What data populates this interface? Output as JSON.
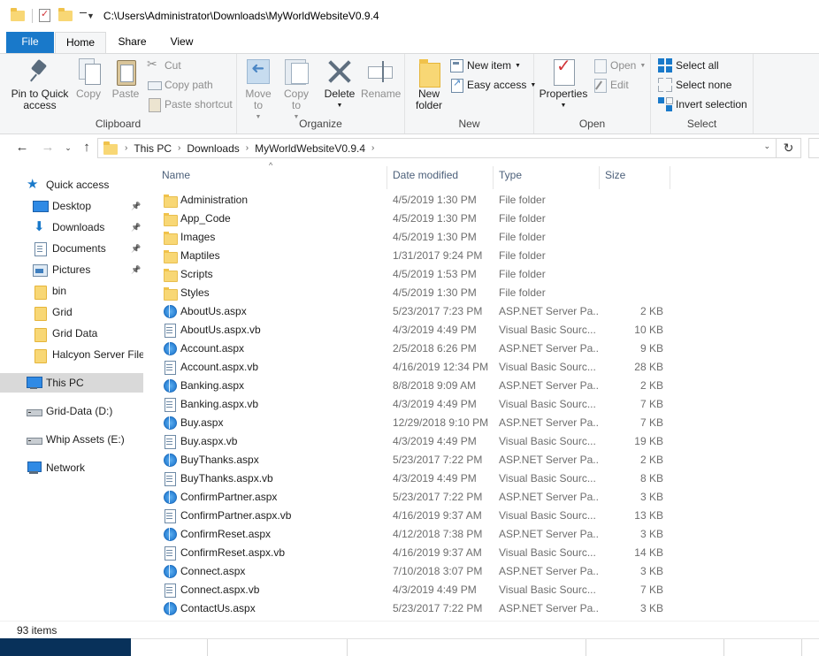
{
  "window": {
    "path": "C:\\Users\\Administrator\\Downloads\\MyWorldWebsiteV0.9.4"
  },
  "tabs": {
    "file": "File",
    "home": "Home",
    "share": "Share",
    "view": "View"
  },
  "ribbon": {
    "clipboard": {
      "label": "Clipboard",
      "pin": "Pin to Quick access",
      "copy": "Copy",
      "paste": "Paste",
      "cut": "Cut",
      "copy_path": "Copy path",
      "paste_shortcut": "Paste shortcut"
    },
    "organize": {
      "label": "Organize",
      "move_to": "Move to",
      "copy_to": "Copy to",
      "delete": "Delete",
      "rename": "Rename"
    },
    "new": {
      "label": "New",
      "new_folder": "New folder",
      "new_item": "New item",
      "easy_access": "Easy access"
    },
    "open": {
      "label": "Open",
      "properties": "Properties",
      "open": "Open",
      "edit": "Edit"
    },
    "select": {
      "label": "Select",
      "select_all": "Select all",
      "select_none": "Select none",
      "invert_selection": "Invert selection"
    }
  },
  "address": {
    "crumbs": [
      "This PC",
      "Downloads",
      "MyWorldWebsiteV0.9.4"
    ]
  },
  "navpane": {
    "items": [
      {
        "label": "Quick access",
        "icon": "star-icon"
      },
      {
        "label": "Desktop",
        "icon": "desktop-icon",
        "pinned": true
      },
      {
        "label": "Downloads",
        "icon": "downloads-icon",
        "pinned": true
      },
      {
        "label": "Documents",
        "icon": "documents-icon",
        "pinned": true
      },
      {
        "label": "Pictures",
        "icon": "pictures-icon",
        "pinned": true
      },
      {
        "label": "bin",
        "icon": "folder-icon"
      },
      {
        "label": "Grid",
        "icon": "folder-icon"
      },
      {
        "label": "Grid Data",
        "icon": "folder-icon"
      },
      {
        "label": "Halcyon Server Files",
        "icon": "folder-icon"
      },
      {
        "label": "This PC",
        "icon": "this-pc-icon",
        "selected": true
      },
      {
        "label": "Grid-Data (D:)",
        "icon": "drive-icon"
      },
      {
        "label": "Whip Assets (E:)",
        "icon": "drive-icon"
      },
      {
        "label": "Network",
        "icon": "network-icon"
      }
    ]
  },
  "columns": {
    "name": "Name",
    "date": "Date modified",
    "type": "Type",
    "size": "Size"
  },
  "files": [
    {
      "name": "Administration",
      "date": "4/5/2019 1:30 PM",
      "type": "File folder",
      "size": "",
      "kind": "folder"
    },
    {
      "name": "App_Code",
      "date": "4/5/2019 1:30 PM",
      "type": "File folder",
      "size": "",
      "kind": "folder"
    },
    {
      "name": "Images",
      "date": "4/5/2019 1:30 PM",
      "type": "File folder",
      "size": "",
      "kind": "folder"
    },
    {
      "name": "Maptiles",
      "date": "1/31/2017 9:24 PM",
      "type": "File folder",
      "size": "",
      "kind": "folder"
    },
    {
      "name": "Scripts",
      "date": "4/5/2019 1:53 PM",
      "type": "File folder",
      "size": "",
      "kind": "folder"
    },
    {
      "name": "Styles",
      "date": "4/5/2019 1:30 PM",
      "type": "File folder",
      "size": "",
      "kind": "folder"
    },
    {
      "name": "AboutUs.aspx",
      "date": "5/23/2017 7:23 PM",
      "type": "ASP.NET Server Pa...",
      "size": "2 KB",
      "kind": "aspx"
    },
    {
      "name": "AboutUs.aspx.vb",
      "date": "4/3/2019 4:49 PM",
      "type": "Visual Basic Sourc...",
      "size": "10 KB",
      "kind": "vb"
    },
    {
      "name": "Account.aspx",
      "date": "2/5/2018 6:26 PM",
      "type": "ASP.NET Server Pa...",
      "size": "9 KB",
      "kind": "aspx"
    },
    {
      "name": "Account.aspx.vb",
      "date": "4/16/2019 12:34 PM",
      "type": "Visual Basic Sourc...",
      "size": "28 KB",
      "kind": "vb"
    },
    {
      "name": "Banking.aspx",
      "date": "8/8/2018 9:09 AM",
      "type": "ASP.NET Server Pa...",
      "size": "2 KB",
      "kind": "aspx"
    },
    {
      "name": "Banking.aspx.vb",
      "date": "4/3/2019 4:49 PM",
      "type": "Visual Basic Sourc...",
      "size": "7 KB",
      "kind": "vb"
    },
    {
      "name": "Buy.aspx",
      "date": "12/29/2018 9:10 PM",
      "type": "ASP.NET Server Pa...",
      "size": "7 KB",
      "kind": "aspx"
    },
    {
      "name": "Buy.aspx.vb",
      "date": "4/3/2019 4:49 PM",
      "type": "Visual Basic Sourc...",
      "size": "19 KB",
      "kind": "vb"
    },
    {
      "name": "BuyThanks.aspx",
      "date": "5/23/2017 7:22 PM",
      "type": "ASP.NET Server Pa...",
      "size": "2 KB",
      "kind": "aspx"
    },
    {
      "name": "BuyThanks.aspx.vb",
      "date": "4/3/2019 4:49 PM",
      "type": "Visual Basic Sourc...",
      "size": "8 KB",
      "kind": "vb"
    },
    {
      "name": "ConfirmPartner.aspx",
      "date": "5/23/2017 7:22 PM",
      "type": "ASP.NET Server Pa...",
      "size": "3 KB",
      "kind": "aspx"
    },
    {
      "name": "ConfirmPartner.aspx.vb",
      "date": "4/16/2019 9:37 AM",
      "type": "Visual Basic Sourc...",
      "size": "13 KB",
      "kind": "vb"
    },
    {
      "name": "ConfirmReset.aspx",
      "date": "4/12/2018 7:38 PM",
      "type": "ASP.NET Server Pa...",
      "size": "3 KB",
      "kind": "aspx"
    },
    {
      "name": "ConfirmReset.aspx.vb",
      "date": "4/16/2019 9:37 AM",
      "type": "Visual Basic Sourc...",
      "size": "14 KB",
      "kind": "vb"
    },
    {
      "name": "Connect.aspx",
      "date": "7/10/2018 3:07 PM",
      "type": "ASP.NET Server Pa...",
      "size": "3 KB",
      "kind": "aspx"
    },
    {
      "name": "Connect.aspx.vb",
      "date": "4/3/2019 4:49 PM",
      "type": "Visual Basic Sourc...",
      "size": "7 KB",
      "kind": "vb"
    },
    {
      "name": "ContactUs.aspx",
      "date": "5/23/2017 7:22 PM",
      "type": "ASP.NET Server Pa...",
      "size": "3 KB",
      "kind": "aspx"
    }
  ],
  "status": {
    "count": "93 items"
  },
  "colors": {
    "accent": "#1979ca",
    "ribbon_bg": "#f5f6f7",
    "folder": "#f8d775"
  }
}
